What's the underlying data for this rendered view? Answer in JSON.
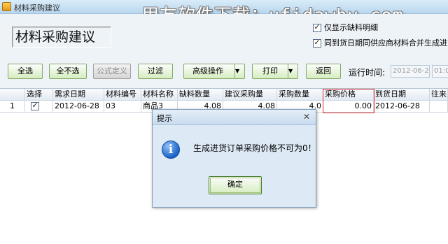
{
  "window": {
    "title": "材料采购建议",
    "watermark": "用友软件下载：ufidawhy.com"
  },
  "page": {
    "title": "材料采购建议"
  },
  "options": [
    {
      "label": "仅显示缺料明细",
      "checked": true
    },
    {
      "label": "同到货日期同供应商材料合并生成进货单",
      "checked": true
    }
  ],
  "toolbar": {
    "select_all": "全选",
    "select_none": "全不选",
    "formula": "公式定义",
    "filter": "过滤",
    "advanced": "高级操作",
    "print": "打印",
    "back": "返回",
    "run_time_label": "运行时间:",
    "run_date": "2012-06-28",
    "run_clock": "01:0"
  },
  "table": {
    "headers": [
      "选择",
      "需求日期",
      "材料编号",
      "材料名称",
      "缺料数量",
      "建议采购量",
      "采购数量",
      "采购价格",
      "到货日期",
      "往来"
    ],
    "rows": [
      {
        "index": "1",
        "selected": true,
        "cells": [
          "2012-06-28",
          "03",
          "商品3",
          "4.08",
          "4.08",
          "4.0",
          "0.00",
          "2012-06-28",
          ""
        ]
      }
    ]
  },
  "dialog": {
    "title": "提示",
    "message": "生成进货订单采购价格不可为0！",
    "ok": "确定",
    "icon": "info-icon"
  },
  "colors": {
    "highlight": "#d92b2b",
    "button_green": "#d6edbf",
    "dialog_bg": "#dde9f5"
  }
}
